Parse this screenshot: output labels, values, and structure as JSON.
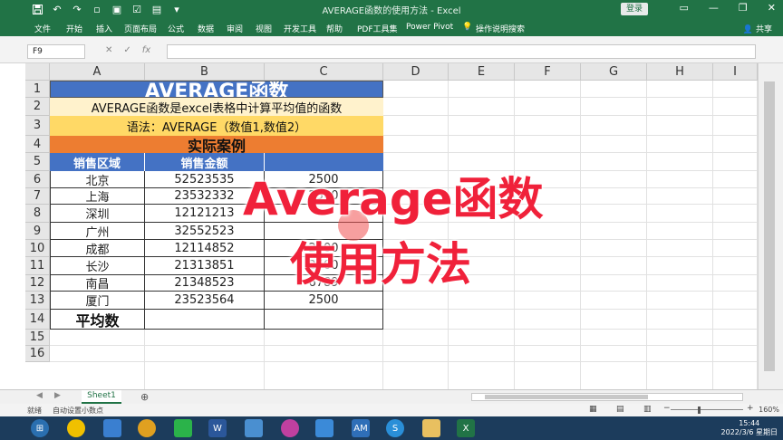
{
  "window": {
    "title": "AVERAGE函数的使用方法 - Excel",
    "login_label": "登录"
  },
  "ribbon": {
    "tabs": [
      "文件",
      "开始",
      "插入",
      "页面布局",
      "公式",
      "数据",
      "审阅",
      "视图",
      "开发工具",
      "帮助",
      "PDF工具集",
      "Power Pivot",
      "操作说明搜索"
    ],
    "share_label": "共享"
  },
  "formula_bar": {
    "name_box": "F9",
    "value": ""
  },
  "columns": [
    "A",
    "B",
    "C",
    "D",
    "E",
    "F",
    "G",
    "H",
    "I"
  ],
  "rows": [
    "1",
    "2",
    "3",
    "4",
    "5",
    "6",
    "7",
    "8",
    "9",
    "10",
    "11",
    "12",
    "13",
    "14",
    "15",
    "16"
  ],
  "table": {
    "title": "AVERAGE函数",
    "description": "AVERAGE函数是excel表格中计算平均值的函数",
    "syntax": "语法：AVERAGE（数值1,数值2）",
    "case_title": "实际案例",
    "headers": [
      "销售区域",
      "销售金额",
      ""
    ],
    "data": [
      [
        "北京",
        "52523535",
        "2500"
      ],
      [
        "上海",
        "23532332",
        "2500"
      ],
      [
        "深圳",
        "12121213",
        ""
      ],
      [
        "广州",
        "32552523",
        ""
      ],
      [
        "成都",
        "12114852",
        "2500"
      ],
      [
        "长沙",
        "21313851",
        "2500"
      ],
      [
        "南昌",
        "21348523",
        "6789"
      ],
      [
        "厦门",
        "23523564",
        "2500"
      ]
    ],
    "average_label": "平均数"
  },
  "overlay": {
    "line1": "Average函数",
    "line2": "使用方法"
  },
  "sheet_tabs": {
    "active": "Sheet1"
  },
  "status": {
    "ready": "就绪",
    "auto_decimal": "自动设置小数点",
    "zoom": "160%"
  },
  "taskbar": {
    "time": "15:44",
    "date": "2022/3/6 星期日"
  },
  "colors": {
    "excel_green": "#217346",
    "title_blue": "#4472c4",
    "desc_yellow": "#fff2cc",
    "syntax_yellow": "#ffd966",
    "case_orange": "#ed7d31",
    "overlay_red": "#f0213a"
  }
}
